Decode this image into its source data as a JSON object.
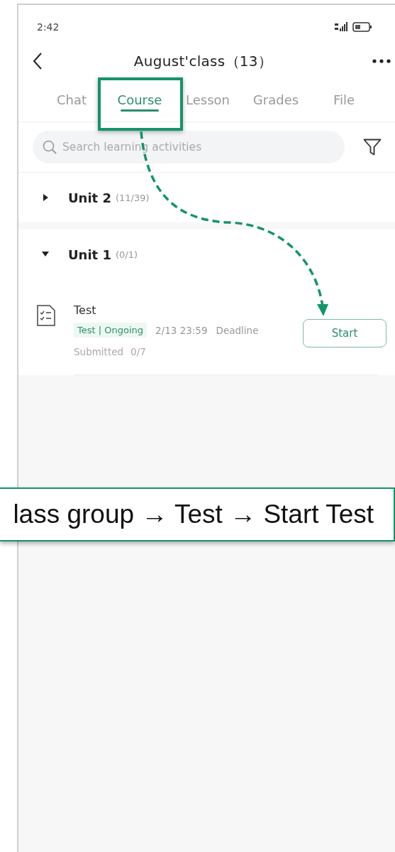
{
  "status_bar": {
    "time": "2:42"
  },
  "header": {
    "title": "August'class（13）"
  },
  "tabs": [
    {
      "label": "Chat",
      "selected": false
    },
    {
      "label": "Course",
      "selected": true
    },
    {
      "label": "Lesson",
      "selected": false
    },
    {
      "label": "Grades",
      "selected": false
    },
    {
      "label": "File",
      "selected": false
    }
  ],
  "search": {
    "placeholder": "Search learning activities"
  },
  "units": [
    {
      "title": "Unit 2",
      "count": "(11/39)",
      "expanded": false
    },
    {
      "title": "Unit 1",
      "count": "(0/1)",
      "expanded": true,
      "activities": [
        {
          "title": "Test",
          "tag": "Test | Ongoing",
          "due": "2/13 23:59",
          "due_label": "Deadline",
          "submitted_label": "Submitted",
          "submitted": "0/7",
          "button": "Start"
        }
      ]
    }
  ],
  "callout": {
    "text": "lass group → Test → Start Test"
  }
}
